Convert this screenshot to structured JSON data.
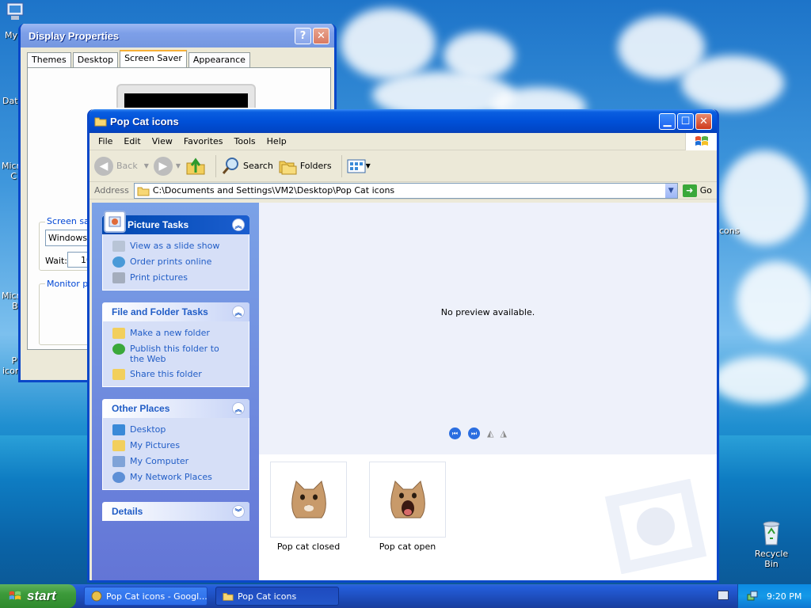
{
  "desktop": {
    "icons": [
      {
        "label": "My"
      },
      {
        "label": "Dat"
      },
      {
        "label": "Micr\nC"
      },
      {
        "label": "Micr\nB"
      },
      {
        "label": "P\nicon"
      },
      {
        "label": "cons"
      }
    ],
    "recycle_bin_label": "Recycle Bin"
  },
  "display_properties": {
    "title": "Display Properties",
    "tabs": [
      "Themes",
      "Desktop",
      "Screen Saver",
      "Appearance"
    ],
    "active_tab": "Screen Saver",
    "screensaver_label": "Screen sav",
    "screensaver_value": "Windows X",
    "wait_label": "Wait:",
    "wait_value": "10",
    "monitor_power_label": "Monitor pow"
  },
  "explorer": {
    "title": "Pop Cat icons",
    "menu": [
      "File",
      "Edit",
      "View",
      "Favorites",
      "Tools",
      "Help"
    ],
    "toolbar": {
      "back": "Back",
      "search": "Search",
      "folders": "Folders"
    },
    "address": {
      "label": "Address",
      "value": "C:\\Documents and Settings\\VM2\\Desktop\\Pop Cat icons",
      "go": "Go"
    },
    "tasks": {
      "picture_tasks": {
        "title": "Picture Tasks",
        "items": [
          "View as a slide show",
          "Order prints online",
          "Print pictures"
        ]
      },
      "file_folder_tasks": {
        "title": "File and Folder Tasks",
        "items": [
          "Make a new folder",
          "Publish this folder to the Web",
          "Share this folder"
        ]
      },
      "other_places": {
        "title": "Other Places",
        "items": [
          "Desktop",
          "My Pictures",
          "My Computer",
          "My Network Places"
        ]
      },
      "details": {
        "title": "Details"
      }
    },
    "preview_text": "No preview available.",
    "files": [
      {
        "name": "Pop cat closed"
      },
      {
        "name": "Pop cat open"
      }
    ]
  },
  "taskbar": {
    "start": "start",
    "buttons": [
      {
        "label": "Pop Cat icons - Googl..."
      },
      {
        "label": "Pop Cat icons"
      }
    ],
    "clock": "9:20 PM"
  },
  "colors": {
    "titlebar_blue": "#0050d8",
    "taskpane_link": "#215dc6",
    "start_green": "#3c9a3a",
    "close_red": "#cf3a1c"
  }
}
